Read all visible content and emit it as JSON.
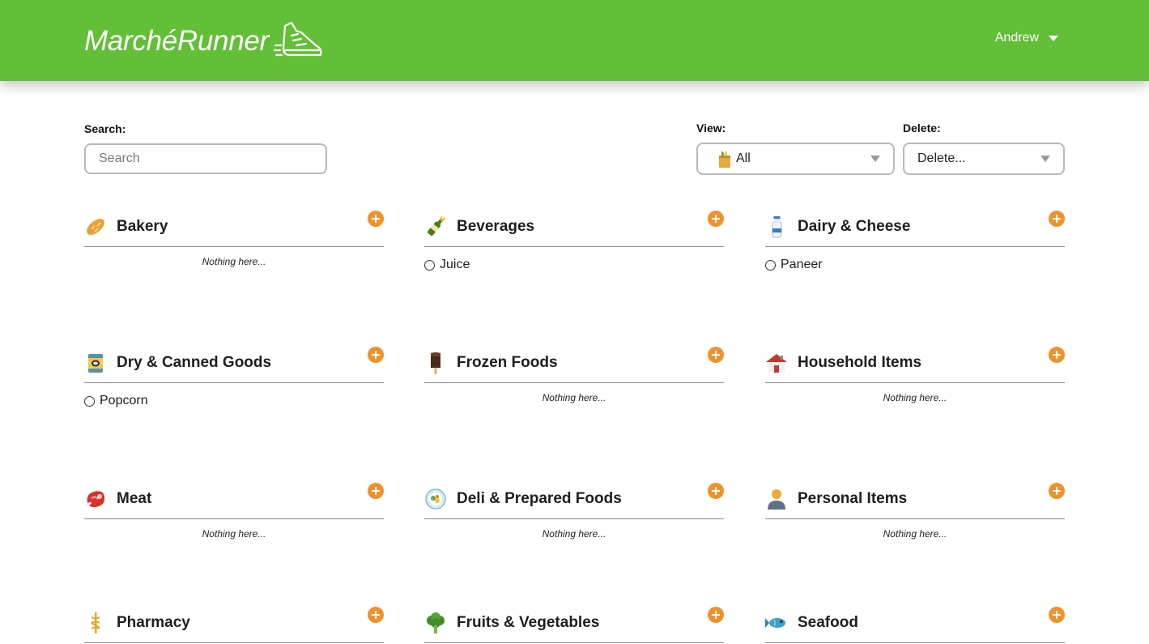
{
  "header": {
    "brand": "MarchéRunner",
    "user_name": "Andrew"
  },
  "search": {
    "label": "Search:",
    "placeholder": "Search",
    "value": ""
  },
  "view": {
    "label": "View:",
    "selected": "All"
  },
  "delete": {
    "label": "Delete:",
    "selected": "Delete..."
  },
  "empty_text": "Nothing here...",
  "colors": {
    "header_green": "#62bf37",
    "add_orange": "#f0922b"
  },
  "categories": [
    {
      "title": "Bakery",
      "icon": "bread-icon",
      "items": []
    },
    {
      "title": "Beverages",
      "icon": "bottle-icon",
      "items": [
        "Juice"
      ]
    },
    {
      "title": "Dairy & Cheese",
      "icon": "milk-icon",
      "items": [
        "Paneer"
      ]
    },
    {
      "title": "Dry & Canned Goods",
      "icon": "can-icon",
      "items": [
        "Popcorn"
      ]
    },
    {
      "title": "Frozen Foods",
      "icon": "ice-pop-icon",
      "items": []
    },
    {
      "title": "Household Items",
      "icon": "house-icon",
      "items": []
    },
    {
      "title": "Meat",
      "icon": "steak-icon",
      "items": []
    },
    {
      "title": "Deli & Prepared Foods",
      "icon": "plate-icon",
      "items": []
    },
    {
      "title": "Personal Items",
      "icon": "person-icon",
      "items": []
    },
    {
      "title": "Pharmacy",
      "icon": "caduceus-icon",
      "items": []
    },
    {
      "title": "Fruits & Vegetables",
      "icon": "broccoli-icon",
      "items": []
    },
    {
      "title": "Seafood",
      "icon": "fish-icon",
      "items": []
    }
  ]
}
